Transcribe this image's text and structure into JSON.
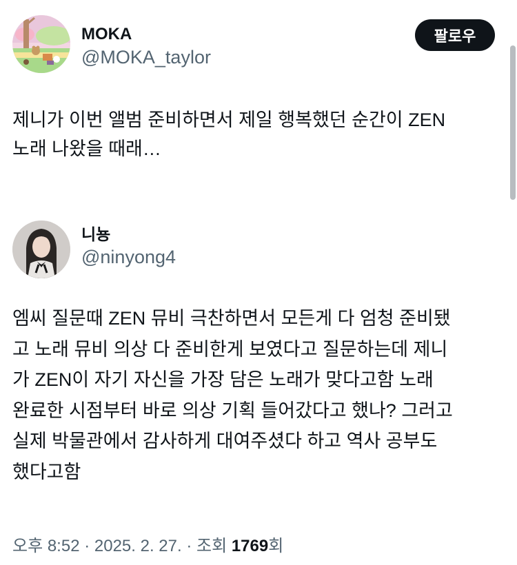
{
  "tweet": {
    "author_name": "MOKA",
    "author_handle": "@MOKA_taylor",
    "follow_label": "팔로우",
    "text": "제니가 이번 앨범 준비하면서 제일 행복했던 순간이 ZEN\n노래 나왔을 때래…"
  },
  "quoted": {
    "author_name": "니뇽",
    "author_handle": "@ninyong4",
    "text": "엠씨 질문때 ZEN 뮤비 극찬하면서 모든게 다 엄청 준비됐\n고 노래 뮤비 의상 다 준비한게 보였다고 질문하는데 제니\n가 ZEN이 자기 자신을 가장 담은 노래가 맞다고함 노래\n완료한 시점부터 바로 의상 기획 들어갔다고 했나? 그러고\n실제 박물관에서 감사하게 대여주셨다 하고 역사 공부도\n했다고함"
  },
  "meta": {
    "time": "오후 8:52",
    "sep1": " · ",
    "date": "2025. 2. 27.",
    "sep2": " · ",
    "views_label": "조회 ",
    "views_count": "1769",
    "views_suffix": "회"
  },
  "colors": {
    "text_primary": "#0f1419",
    "text_secondary": "#536471",
    "follow_bg": "#0f1419"
  },
  "icons": {
    "main_avatar": "cartoon-forest-avatar",
    "quoted_avatar": "profile-photo-avatar"
  }
}
